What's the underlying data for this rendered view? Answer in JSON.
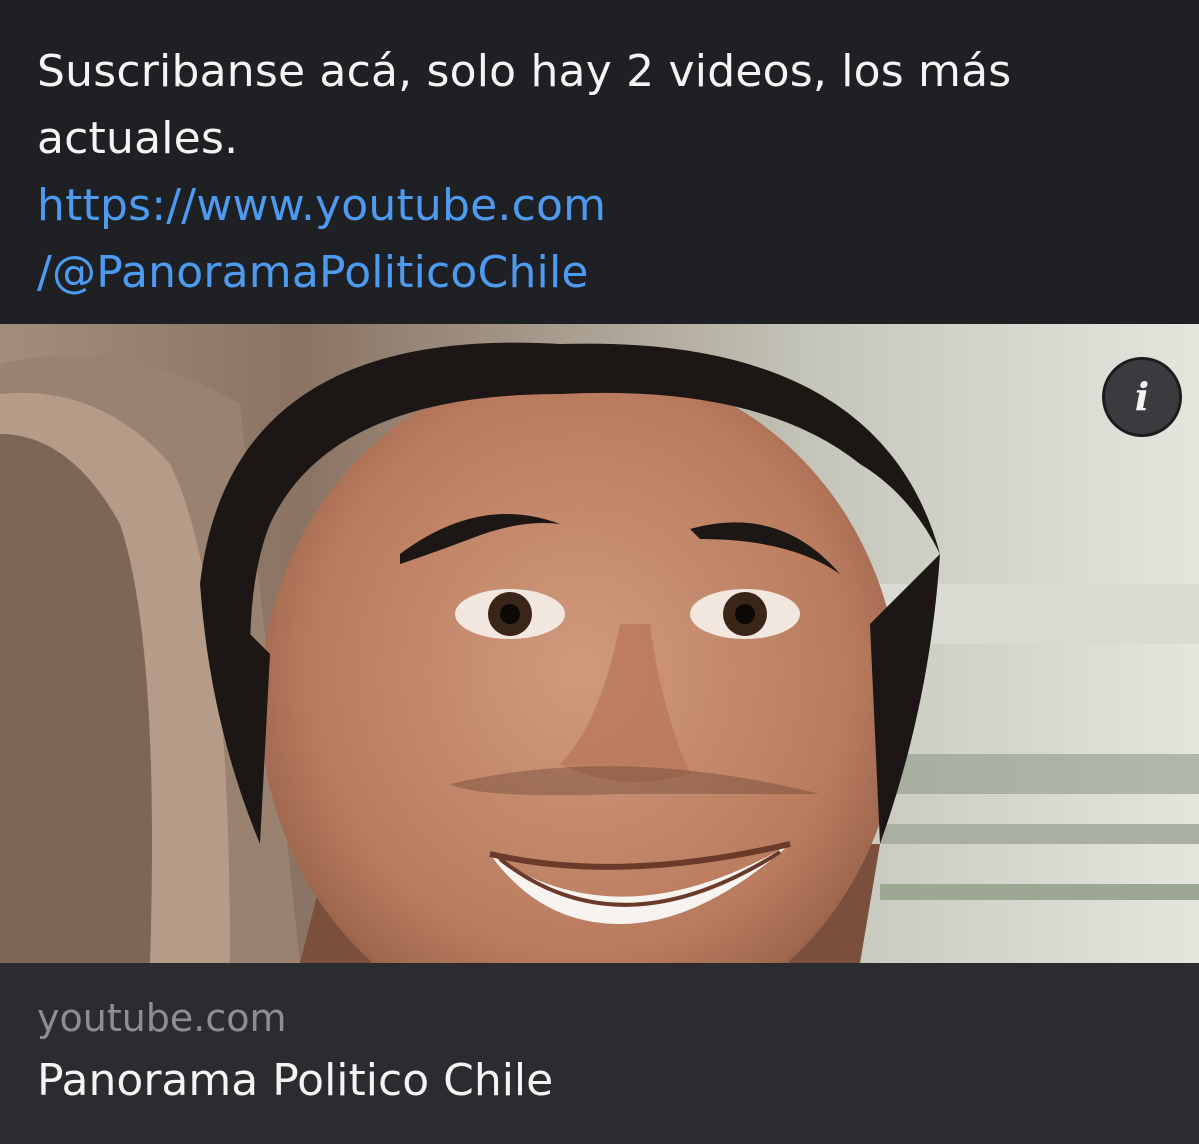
{
  "message": {
    "text": "Suscribanse acá, solo hay 2 videos, los más actuales.",
    "link_line1": "https://www.youtube.com",
    "link_line2": "/@PanoramaPoliticoChile"
  },
  "preview": {
    "info_icon": "info-icon",
    "info_glyph": "i",
    "domain": "youtube.com",
    "title": "Panorama Politico Chile"
  },
  "colors": {
    "background": "#1f2023",
    "card": "#2b2c2f",
    "link": "#4c9bf0",
    "text": "#f4f4f4",
    "muted": "#8d8e91"
  }
}
